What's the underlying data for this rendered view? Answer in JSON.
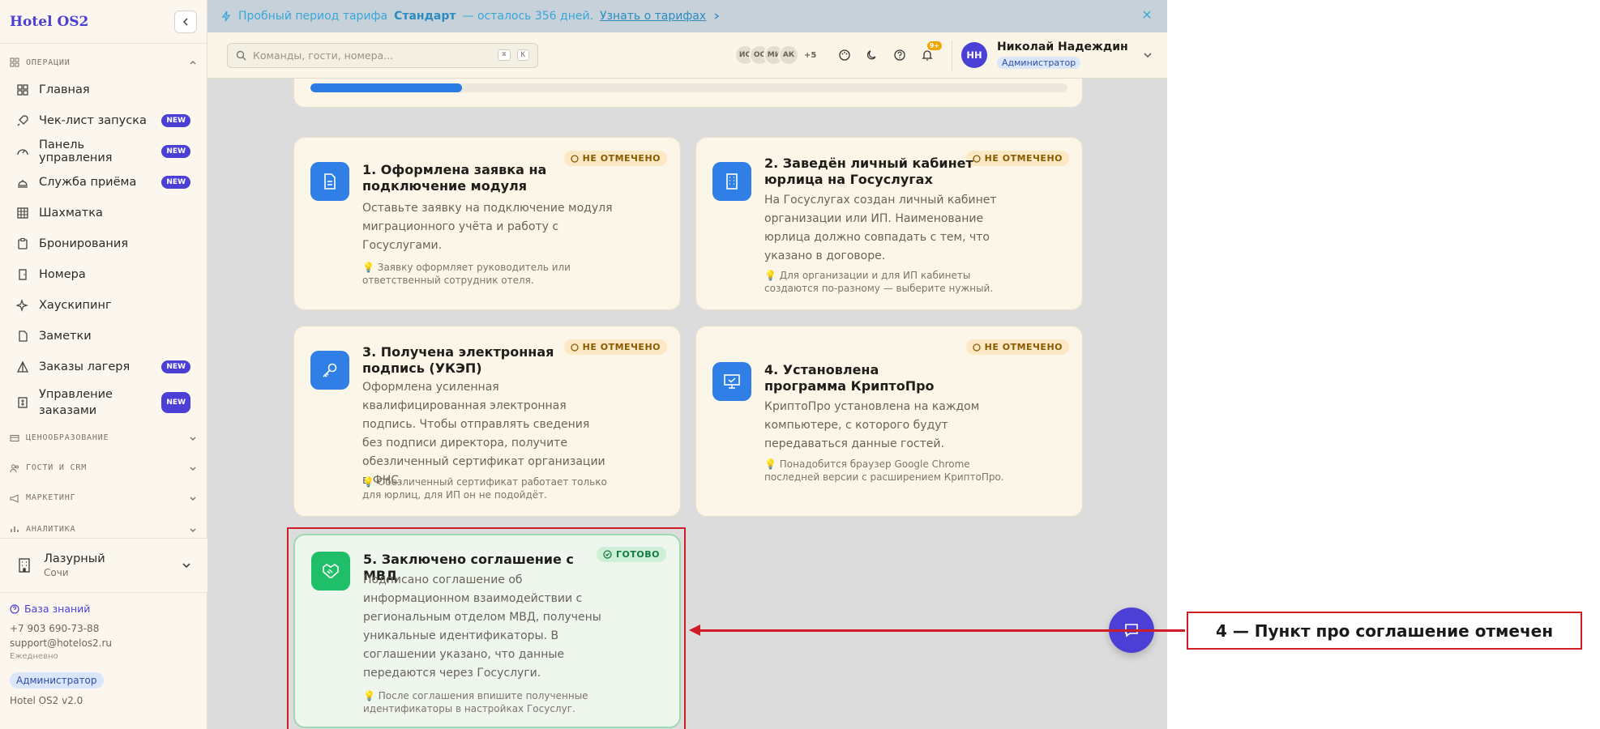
{
  "sidebar": {
    "brand": "Hotel OS2",
    "sections": {
      "operations": "ОПЕРАЦИИ"
    },
    "items": [
      {
        "label": "Главная",
        "badge": ""
      },
      {
        "label": "Чек-лист запуска",
        "badge": "NEW"
      },
      {
        "label": "Панель управления",
        "badge": "NEW"
      },
      {
        "label": "Служба приёма",
        "badge": "NEW"
      },
      {
        "label": "Шахматка",
        "badge": ""
      },
      {
        "label": "Бронирования",
        "badge": ""
      },
      {
        "label": "Номера",
        "badge": ""
      },
      {
        "label": "Хаускипинг",
        "badge": ""
      },
      {
        "label": "Заметки",
        "badge": ""
      },
      {
        "label": "Заказы лагеря",
        "badge": "NEW"
      },
      {
        "label": "Управление заказами",
        "badge": "NEW"
      }
    ],
    "groups": [
      "ЦЕНООБРАЗОВАНИЕ",
      "ГОСТИ И CRM",
      "МАРКЕТИНГ",
      "АНАЛИТИКА"
    ],
    "hotel": {
      "name": "Лазурный",
      "city": "Сочи"
    },
    "footer": {
      "kb": "База знаний",
      "phone": "+7 903 690-73-88",
      "email": "support@hotelos2.ru",
      "schedule": "Ежедневно",
      "role": "Администратор",
      "version": "Hotel OS2 v2.0"
    }
  },
  "trial": {
    "pre": "Пробный период тарифа",
    "plan": "Стандарт",
    "post": "— осталось 356 дней.",
    "link": "Узнать о тарифах"
  },
  "topbar": {
    "search_placeholder": "Команды, гости, номера...",
    "kbd1": "⌘",
    "kbd2": "K",
    "avatars": [
      "ИС",
      "ОС",
      "МИ",
      "АК"
    ],
    "more": "+5",
    "notif_count": "9+",
    "user": {
      "initials": "НН",
      "name": "Николай Надеждин",
      "role": "Администратор"
    }
  },
  "progress": {
    "value": 0.2
  },
  "colors": {
    "accent": "#4c3fd6",
    "blue_icon": "#2f7fe6",
    "green_icon": "#1fbf6a",
    "annotation": "#d01c24"
  },
  "cards": [
    {
      "title": "1. Оформлена заявка на подключение модуля",
      "desc": "Оставьте заявку на подключение модуля миграционного учёта и работу с Госуслугами.",
      "tip": "💡 Заявку оформляет руководитель или ответственный сотрудник отеля.",
      "status": "НЕ ОТМЕЧЕНО",
      "icon": "document-icon"
    },
    {
      "title": "2. Заведён личный кабинет юрлица на Госуслугах",
      "desc": "На Госуслугах создан личный кабинет организации или ИП. Наименование юрлица должно совпадать с тем, что указано в договоре.",
      "tip": "💡 Для организации и для ИП кабинеты создаются по-разному — выберите нужный.",
      "status": "НЕ ОТМЕЧЕНО",
      "icon": "building-icon"
    },
    {
      "title": "3. Получена электронная подпись (УКЭП)",
      "desc": "Оформлена усиленная квалифицированная электронная подпись. Чтобы отправлять сведения без подписи директора, получите обезличенный сертификат организации в ФНС.",
      "tip": "💡 Обезличенный сертификат работает только для юрлиц, для ИП он не подойдёт.",
      "status": "НЕ ОТМЕЧЕНО",
      "icon": "key-icon"
    },
    {
      "title": "4. Установлена программа КриптоПро",
      "desc": "КриптоПро установлена на каждом компьютере, с которого будут передаваться данные гостей.",
      "tip": "💡 Понадобится браузер Google Chrome последней версии с расширением КриптоПро.",
      "status": "НЕ ОТМЕЧЕНО",
      "icon": "monitor-icon"
    },
    {
      "title": "5. Заключено соглашение с МВД",
      "desc": "Подписано соглашение об информационном взаимодействии с региональным отделом МВД, получены уникальные идентификаторы. В соглашении указано, что данные передаются через Госуслуги.",
      "tip": "💡 После соглашения впишите полученные идентификаторы в настройках Госуслуг.",
      "status": "ГОТОВО",
      "icon": "handshake-icon"
    }
  ],
  "annotation": {
    "text": "4 — Пункт про соглашение отмечен"
  }
}
